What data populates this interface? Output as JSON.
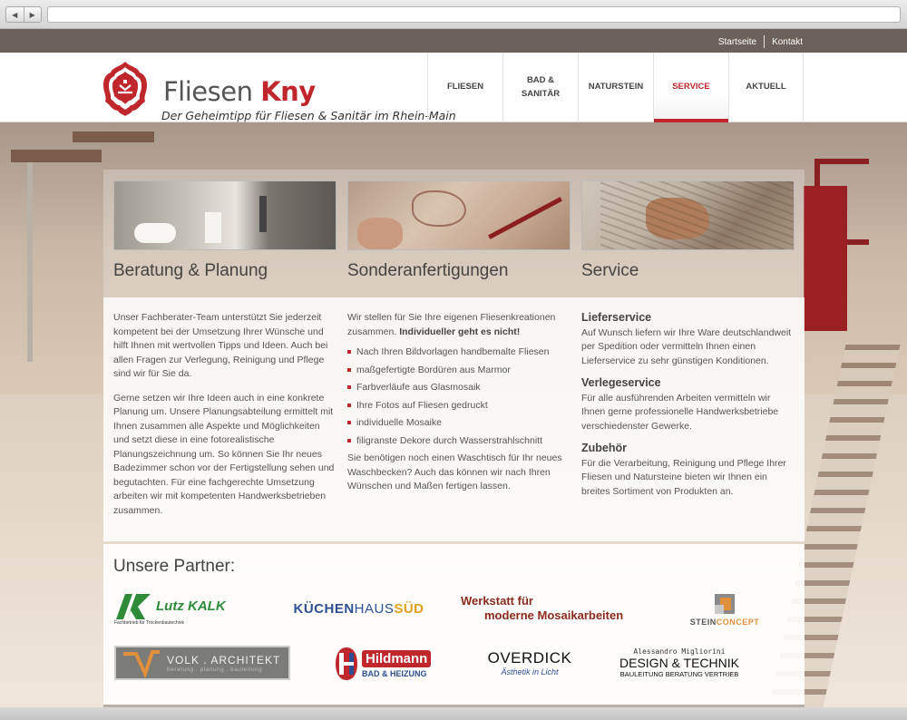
{
  "top_links": {
    "home": "Startseite",
    "contact": "Kontakt"
  },
  "logo": {
    "name_part1": "Fliesen",
    "name_part2": "Kny",
    "tagline": "Der Geheimtipp für Fliesen & Sanitär im Rhein-Main"
  },
  "nav": [
    {
      "line1": "FLIESEN",
      "line2": ""
    },
    {
      "line1": "BAD &",
      "line2": "SANITÄR"
    },
    {
      "line1": "NATURSTEIN",
      "line2": ""
    },
    {
      "line1": "SERVICE",
      "line2": ""
    },
    {
      "line1": "AKTUELL",
      "line2": ""
    }
  ],
  "active_nav": "SERVICE",
  "colors": {
    "brand_red": "#c0272d",
    "topbar": "#6b6159"
  },
  "columns": {
    "beratung": {
      "title": "Beratung & Planung",
      "p1": "Unser Fachberater-Team unterstützt Sie jederzeit kompetent bei der Umsetzung Ihrer Wünsche und hilft Ihnen mit wertvollen Tipps und Ideen. Auch bei allen Fragen zur Verlegung, Reinigung und Pflege sind wir für Sie da.",
      "p2": "Gerne setzen wir Ihre Ideen auch in eine konkrete Planung um. Unsere Planungsabteilung ermittelt mit Ihnen zusammen alle Aspekte und Möglichkeiten und setzt diese in eine fotoreal­istische Planungszeichnung um. So können Sie Ihr neues Badezimmer schon vor der Fertigstellung sehen und begutachten. Für eine fachgerechte Umsetzung arbeiten wir mit kompetenten Handwerksbetrieben zusammen."
    },
    "sonder": {
      "title": "Sonderanfertigungen",
      "intro": "Wir stellen für Sie Ihre eigenen Fliesenkreationen zusammen.",
      "intro_bold": "Individueller geht es nicht!",
      "items": [
        "Nach Ihren Bildvorlagen handbemalte Fliesen",
        "maßgefertigte Bordüren aus Marmor",
        "Farbverläufe aus Glasmosaik",
        "Ihre Fotos auf Fliesen gedruckt",
        "individuelle Mosaike",
        "filigranste Dekore durch Wasserstrahlschnitt"
      ],
      "outro": "Sie benötigen noch einen Waschtisch für Ihr neues Waschbecken? Auch das können wir nach Ihren Wünschen und Maßen fertigen lassen."
    },
    "service": {
      "title": "Service",
      "sections": [
        {
          "heading": "Lieferservice",
          "text": "Auf Wunsch liefern wir Ihre Ware deutschland­weit per Spedition oder vermitteln Ihnen einen Lieferservice zu sehr günstigen Konditionen."
        },
        {
          "heading": "Verlegeservice",
          "text": "Für alle ausführenden Arbeiten vermitteln wir Ihnen gerne professionelle Handwerksbetriebe verschiedenster Gewerke."
        },
        {
          "heading": "Zubehör",
          "text": "Für die Verarbeitung, Reinigung und Pflege Ihrer Fliesen und Natursteine bieten wir Ihnen ein breites Sortiment von Produkten an."
        }
      ]
    }
  },
  "partners": {
    "title": "Unsere Partner:",
    "lutz": {
      "name": "Lutz KALK",
      "sub": "Fachbetrieb für Trockenbautechnik"
    },
    "kuechenhaus": {
      "part1": "KÜCHEN",
      "part2": "HAUS",
      "part3": " SÜD"
    },
    "werkstatt": {
      "line1": "Werkstatt für",
      "line2": "moderne Mosaikarbeiten"
    },
    "steinconcept": {
      "part1": "STEIN",
      "part2": "CONCEPT"
    },
    "volk": {
      "name": "VOLK . ARCHITEKT",
      "sub": "beratung . planung . bauleitung"
    },
    "hildmann": {
      "name": "Hildmann",
      "sub": "BAD & HEIZUNG"
    },
    "overdick": {
      "name": "OVERDICK",
      "sub": "Ästhetik in Licht"
    },
    "migliorini": {
      "top": "Alessandro Migliorini",
      "name": "DESIGN & TECHNIK",
      "sub": "BAULEITUNG BERATUNG VERTRIEB"
    }
  }
}
